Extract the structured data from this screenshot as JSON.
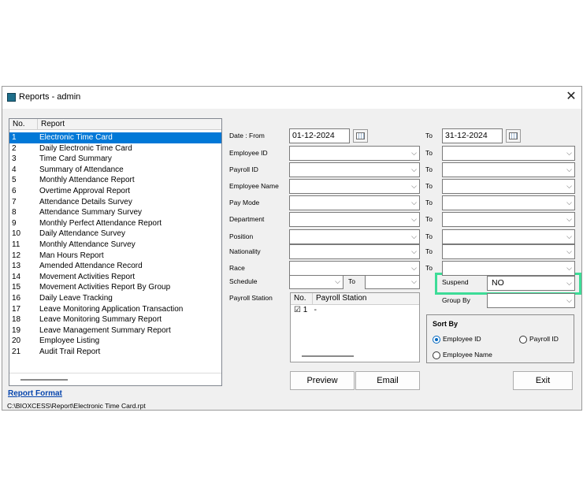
{
  "window": {
    "title": "Reports - admin",
    "close_glyph": "✕"
  },
  "report_list": {
    "col_no": "No.",
    "col_report": "Report",
    "selected": 0,
    "items": [
      {
        "no": "1",
        "name": "Electronic Time Card"
      },
      {
        "no": "2",
        "name": "Daily Electronic Time Card"
      },
      {
        "no": "3",
        "name": "Time Card Summary"
      },
      {
        "no": "4",
        "name": "Summary of Attendance"
      },
      {
        "no": "5",
        "name": "Monthly Attendance Report"
      },
      {
        "no": "6",
        "name": "Overtime Approval Report"
      },
      {
        "no": "7",
        "name": "Attendance Details Survey"
      },
      {
        "no": "8",
        "name": "Attendance Summary Survey"
      },
      {
        "no": "9",
        "name": "Monthly Perfect Attendance Report"
      },
      {
        "no": "10",
        "name": "Daily Attendance Survey"
      },
      {
        "no": "11",
        "name": "Monthly Attendance Survey"
      },
      {
        "no": "12",
        "name": "Man Hours Report"
      },
      {
        "no": "13",
        "name": "Amended Attendance Record"
      },
      {
        "no": "14",
        "name": "Movement Activities Report"
      },
      {
        "no": "15",
        "name": "Movement Activities Report By Group"
      },
      {
        "no": "16",
        "name": "Daily Leave Tracking"
      },
      {
        "no": "17",
        "name": "Leave Monitoring Application Transaction"
      },
      {
        "no": "18",
        "name": "Leave Monitoring Summary Report"
      },
      {
        "no": "19",
        "name": "Leave Management Summary Report"
      },
      {
        "no": "20",
        "name": "Employee Listing"
      },
      {
        "no": "21",
        "name": "Audit Trail Report"
      }
    ]
  },
  "report_format": {
    "label": "Report Format",
    "path": "C:\\BIOXCESS\\Report\\Electronic Time Card.rpt"
  },
  "filters": {
    "date_from_label": "Date : From",
    "date_from": "01-12-2024",
    "to_label": "To",
    "date_to": "31-12-2024",
    "employee_id_label": "Employee ID",
    "payroll_id_label": "Payroll ID",
    "employee_name_label": "Employee Name",
    "pay_mode_label": "Pay Mode",
    "department_label": "Department",
    "position_label": "Position",
    "nationality_label": "Nationality",
    "race_label": "Race",
    "schedule_label": "Schedule",
    "payroll_station_label": "Payroll Station",
    "suspend_label": "Suspend",
    "suspend_value": "NO",
    "group_by_label": "Group By"
  },
  "payroll_station_grid": {
    "col_no": "No.",
    "col_station": "Payroll Station",
    "rows": [
      {
        "checked": "☑",
        "no": "1",
        "name": "-"
      }
    ]
  },
  "sort_by": {
    "title": "Sort By",
    "option_employee_id": "Employee ID",
    "option_payroll_id": "Payroll ID",
    "option_employee_name": "Employee Name",
    "selected": "employee_id"
  },
  "buttons": {
    "preview": "Preview",
    "email": "Email",
    "exit": "Exit"
  },
  "chevron": "⌵"
}
